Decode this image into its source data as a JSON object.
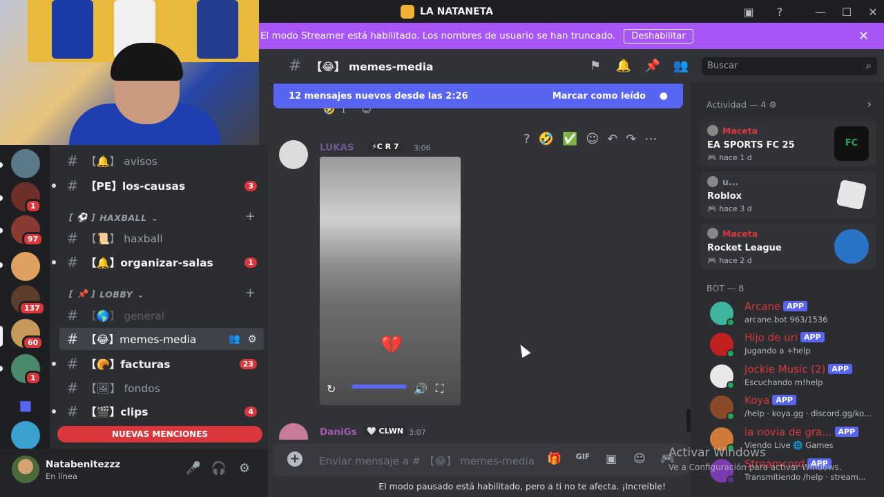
{
  "window": {
    "title": "LA NATANETA",
    "colors": {
      "accent": "#5865f2",
      "banner": "#a855f7",
      "danger": "#da373c",
      "online": "#23a55a"
    }
  },
  "banner": {
    "text": "El modo Streamer está habilitado. Los nombres de usuario se han truncado.",
    "button": "Deshabilitar"
  },
  "servers": [
    {
      "badge": ""
    },
    {
      "badge": "1"
    },
    {
      "badge": "97"
    },
    {
      "badge": ""
    },
    {
      "badge": "137"
    },
    {
      "badge": "60"
    },
    {
      "badge": "1"
    },
    {
      "badge": ""
    }
  ],
  "channels": {
    "items": [
      {
        "emoji": "【🔔】",
        "name": "avisos",
        "state": "normal",
        "count": ""
      },
      {
        "emoji": "【PE】",
        "name": "los-causas",
        "state": "unread",
        "count": "3"
      },
      {
        "emoji": "【📜】",
        "name": "haxball",
        "state": "normal",
        "count": ""
      },
      {
        "emoji": "【🔔】",
        "name": "organizar-salas",
        "state": "unread",
        "count": "1"
      },
      {
        "emoji": "【🌎】",
        "name": "general",
        "state": "muted",
        "count": ""
      },
      {
        "emoji": "【😂】",
        "name": "memes-media",
        "state": "selected",
        "count": ""
      },
      {
        "emoji": "【🥐】",
        "name": "facturas",
        "state": "unread",
        "count": "23"
      },
      {
        "emoji": "【🖼】",
        "name": "fondos",
        "state": "normal",
        "count": ""
      },
      {
        "emoji": "【🎬】",
        "name": "clips",
        "state": "unread",
        "count": "4"
      }
    ],
    "categories": [
      {
        "emoji": "[ ⚽ ]",
        "name": "HAXBALL"
      },
      {
        "emoji": "[ 📌 ]",
        "name": "LOBBY"
      }
    ],
    "mentions_label": "NUEVAS MENCIONES"
  },
  "user": {
    "name": "Natabenitezzz",
    "status": "En línea"
  },
  "header": {
    "channel": "【😂】 memes-media",
    "search_placeholder": "Buscar"
  },
  "new_messages": {
    "text": "12 mensajes nuevos desde las 2:26",
    "action": "Marcar como leído"
  },
  "messages": [
    {
      "author": "LUKAS",
      "tag": "⚡C R 7",
      "time": "3:06"
    },
    {
      "author": "DaniGs",
      "tag": "🤍 CLWN",
      "time": "3:07"
    }
  ],
  "reactions": {
    "count": "1"
  },
  "composer": {
    "placeholder": "Enviar mensaje a # 【😂】 memes-media"
  },
  "pause_notice": "El modo pausado está habilitado, pero a ti no te afecta. ¡Increíble!",
  "members": {
    "activity_title": "Actividad — 4",
    "activities": [
      {
        "user": "Maceta",
        "game": "EA SPORTS FC 25",
        "ago": "🎮 hace 1 d"
      },
      {
        "user": "u...",
        "game": "Roblox",
        "ago": "🎮 hace 3 d"
      },
      {
        "user": "Maceta",
        "game": "Rocket League",
        "ago": "🎮 hace 2 d"
      }
    ],
    "bot_title": "BOT — 8",
    "bots": [
      {
        "name": "Arcane",
        "status": "arcane.bot 963/1536"
      },
      {
        "name": "Hijo de uri",
        "status": "Jugando a +help"
      },
      {
        "name": "Jockie Music (2)",
        "status": "Escuchando m!help"
      },
      {
        "name": "Koya",
        "status": "/help · koya.gg · discord.gg/ko..."
      },
      {
        "name": "la novia de gra...",
        "status": "Viendo Live 🌐 Games"
      },
      {
        "name": "Streamcord",
        "status": "Transmitiendo /help · stream..."
      }
    ],
    "app_label": "APP"
  },
  "watermark": {
    "line1": "Activar Windows",
    "line2": "Ve a Configuración para activar Windows."
  }
}
